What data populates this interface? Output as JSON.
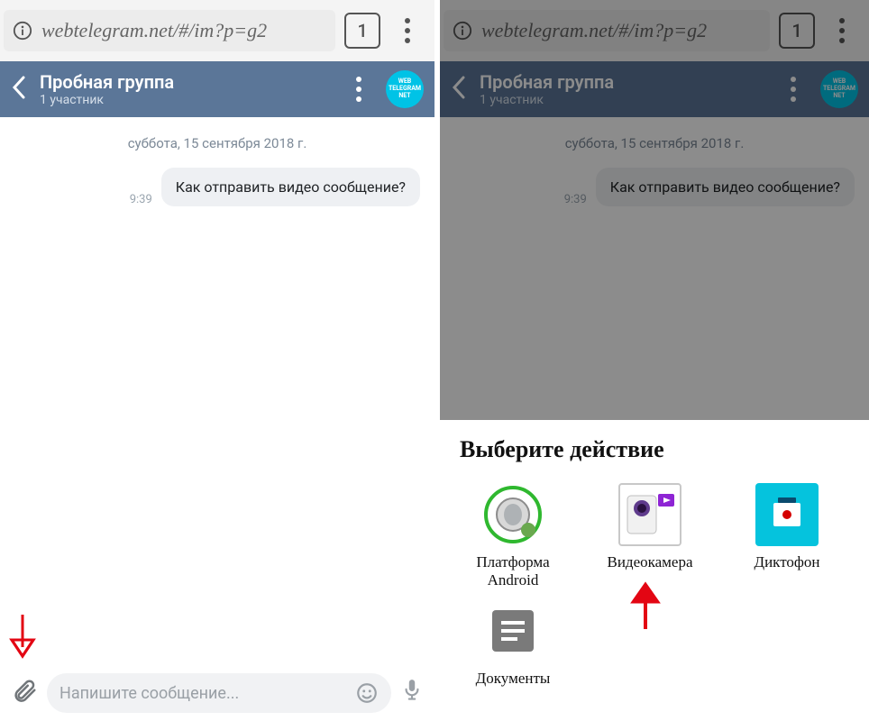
{
  "browser": {
    "url": "webtelegram.net/#/im?p=g2",
    "tab_count": "1"
  },
  "chat": {
    "title": "Пробная группа",
    "subtitle": "1 участник",
    "avatar_lines": [
      "WEB",
      "TELEGRAM",
      "NET"
    ],
    "date_separator": "суббота, 15 сентября 2018 г.",
    "message": {
      "time": "9:39",
      "text": "Как отправить видео сообщение?"
    },
    "compose_placeholder": "Напишите сообщение..."
  },
  "sheet": {
    "title": "Выберите действие",
    "items": [
      {
        "label": "Платформа Android",
        "icon": "android-platform"
      },
      {
        "label": "Видеокамера",
        "icon": "video-camera"
      },
      {
        "label": "Диктофон",
        "icon": "voice-recorder"
      },
      {
        "label": "Документы",
        "icon": "documents"
      }
    ]
  }
}
